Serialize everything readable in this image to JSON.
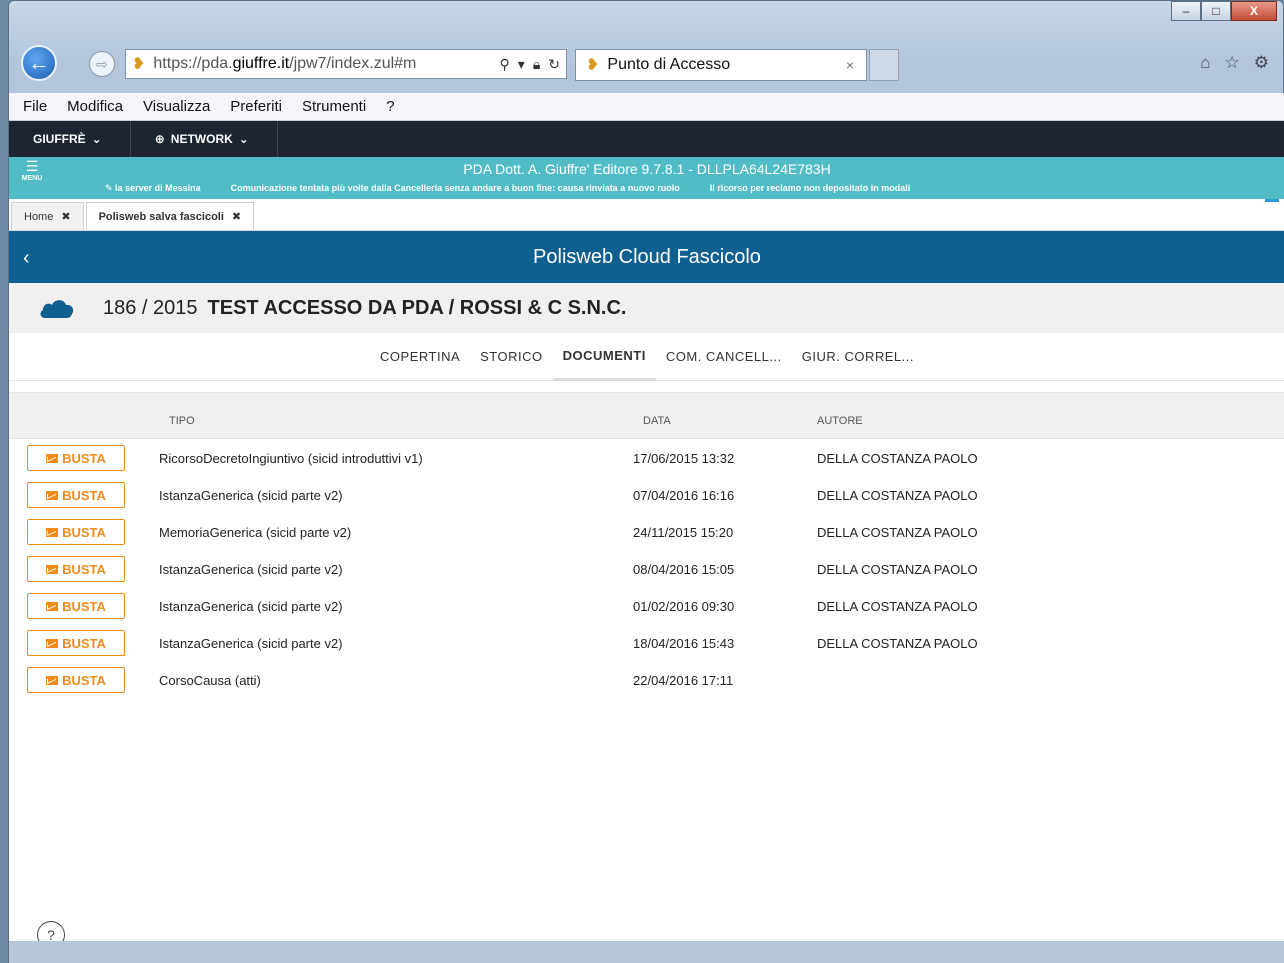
{
  "browser": {
    "url_prefix": "https://pda.",
    "url_host": "giuffre.it",
    "url_path": "/jpw7/index.zul#m",
    "tab_title": "Punto di Accesso",
    "tab_close": "×",
    "window_controls": {
      "minimize": "–",
      "maximize": "□",
      "close": "X"
    }
  },
  "menubar": [
    "File",
    "Modifica",
    "Visualizza",
    "Preferiti",
    "Strumenti",
    "?"
  ],
  "topnav": [
    "GIUFFRÈ",
    "NETWORK"
  ],
  "banner": {
    "menu_label": "MENU",
    "title": "PDA Dott. A. Giuffre' Editore 9.7.8.1   -   DLLPLA64L24E783H",
    "tickers": [
      "la server di Messina",
      "Comunicazione tentata più volte dalla Cancelleria senza andare a buon fine: causa rinviata a nuovo ruolo",
      "Il ricorso per reclamo non depositato in modali"
    ]
  },
  "app_tabs": [
    {
      "label": "Home",
      "close": "✖"
    },
    {
      "label": "Polisweb salva fascicoli",
      "close": "✖"
    }
  ],
  "header": {
    "title": "Polisweb Cloud Fascicolo",
    "back": "‹"
  },
  "case": {
    "number": "186 / 2015",
    "name": "TEST ACCESSO DA PDA / ROSSI & C S.N.C."
  },
  "subtabs": [
    "COPERTINA",
    "STORICO",
    "DOCUMENTI",
    "COM. CANCELL...",
    "GIUR. CORREL..."
  ],
  "active_subtab": "DOCUMENTI",
  "table": {
    "headers": {
      "tipo": "TIPO",
      "data": "DATA",
      "autore": "AUTORE"
    },
    "button_label": "BUSTA",
    "rows": [
      {
        "tipo": "RicorsoDecretoIngiuntivo (sicid introduttivi v1)",
        "data": "17/06/2015 13:32",
        "autore": "DELLA COSTANZA PAOLO"
      },
      {
        "tipo": "IstanzaGenerica (sicid parte v2)",
        "data": "07/04/2016 16:16",
        "autore": "DELLA COSTANZA PAOLO"
      },
      {
        "tipo": "MemoriaGenerica (sicid parte v2)",
        "data": "24/11/2015 15:20",
        "autore": "DELLA COSTANZA PAOLO"
      },
      {
        "tipo": "IstanzaGenerica (sicid parte v2)",
        "data": "08/04/2016 15:05",
        "autore": "DELLA COSTANZA PAOLO"
      },
      {
        "tipo": "IstanzaGenerica (sicid parte v2)",
        "data": "01/02/2016 09:30",
        "autore": "DELLA COSTANZA PAOLO"
      },
      {
        "tipo": "IstanzaGenerica (sicid parte v2)",
        "data": "18/04/2016 15:43",
        "autore": "DELLA COSTANZA PAOLO"
      },
      {
        "tipo": "CorsoCausa (atti)",
        "data": "22/04/2016 17:11",
        "autore": ""
      }
    ]
  },
  "help": "?",
  "colors": {
    "teal": "#51bcc6",
    "header_blue": "#0f5f91",
    "accent_orange": "#f08c1c",
    "dark_nav": "#1c2530"
  }
}
